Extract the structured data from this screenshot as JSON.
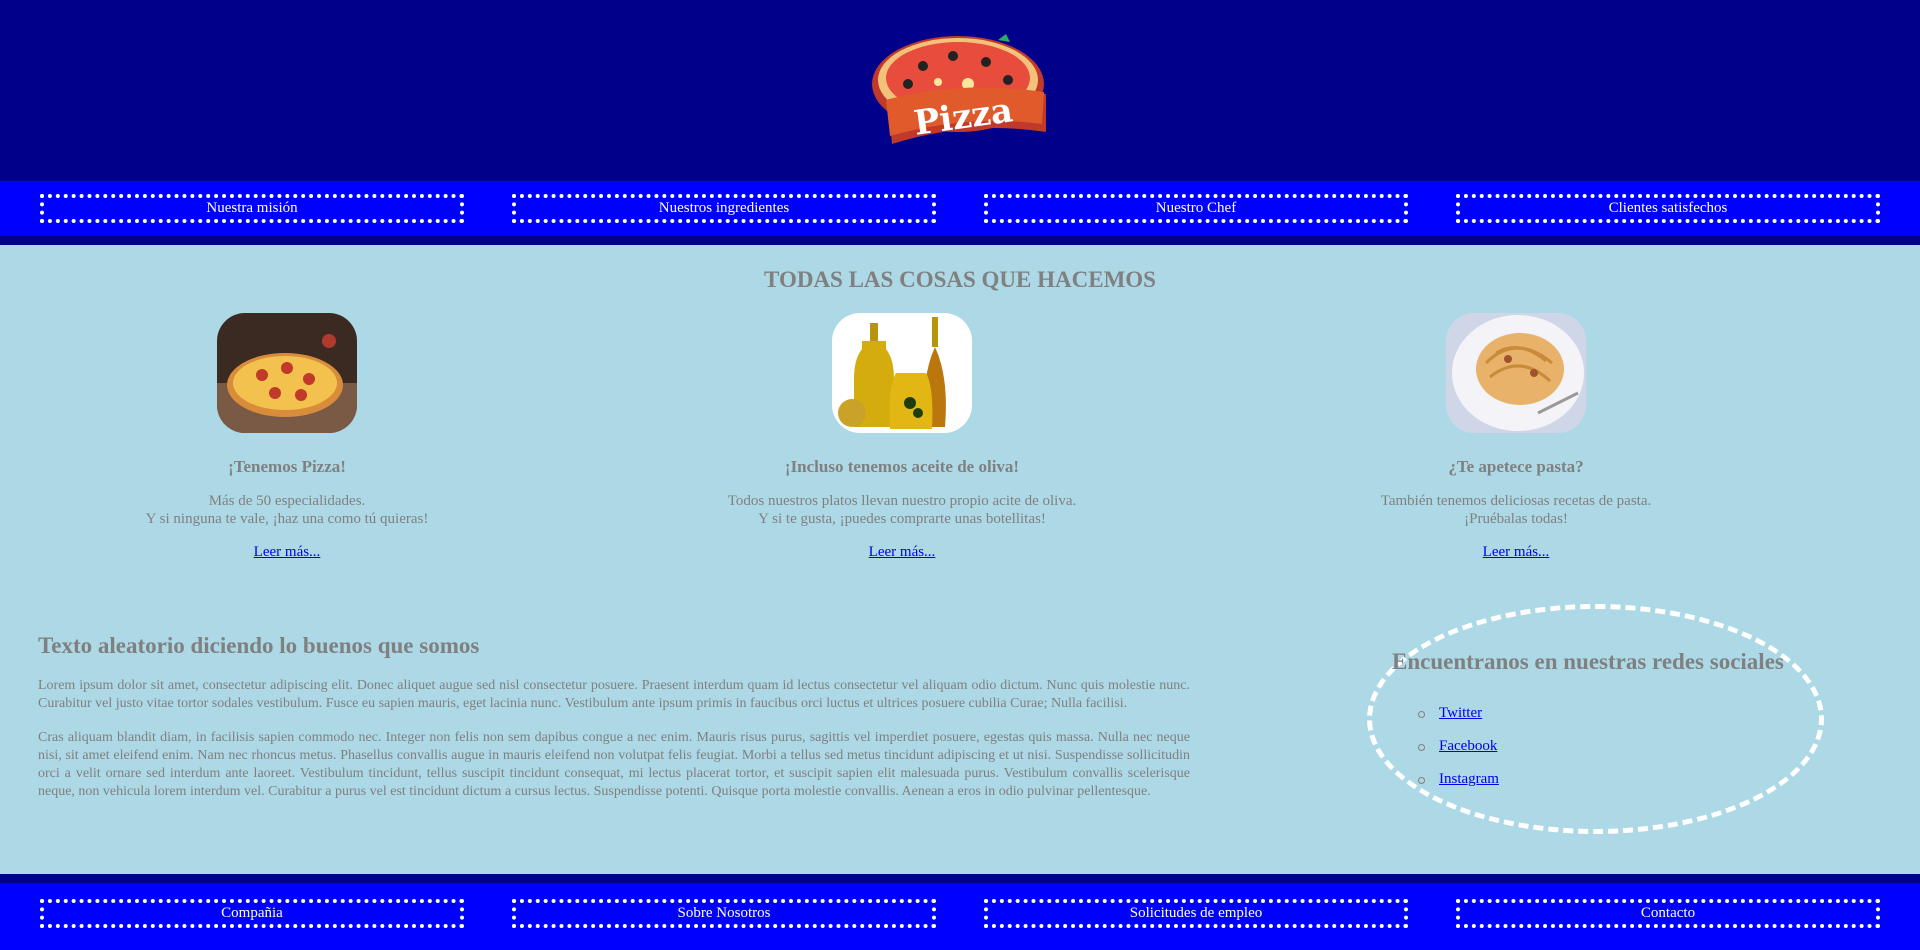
{
  "header": {
    "logo_text": "Pizza"
  },
  "nav": {
    "items": [
      {
        "label": "Nuestra misión"
      },
      {
        "label": "Nuestros ingredientes"
      },
      {
        "label": "Nuestro Chef"
      },
      {
        "label": "Clientes satisfechos"
      }
    ]
  },
  "main": {
    "title": "TODAS LAS COSAS QUE HACEMOS",
    "features": [
      {
        "title": "¡Tenemos Pizza!",
        "line1": "Más de 50 especialidades.",
        "line2": "Y si ninguna te vale, ¡haz una como tú quieras!",
        "link": "Leer más..."
      },
      {
        "title": "¡Incluso tenemos aceite de oliva!",
        "line1": "Todos nuestros platos llevan nuestro propio acite de oliva.",
        "line2": "Y si te gusta, ¡puedes comprarte unas botellitas!",
        "link": "Leer más..."
      },
      {
        "title": "¿Te apetece pasta?",
        "line1": "También tenemos deliciosas recetas de pasta.",
        "line2": "¡Pruébalas todas!",
        "link": "Leer más..."
      }
    ]
  },
  "about": {
    "title": "Texto aleatorio diciendo lo buenos que somos",
    "p1": "Lorem ipsum dolor sit amet, consectetur adipiscing elit. Donec aliquet augue sed nisl consectetur posuere. Praesent interdum quam id lectus consectetur vel aliquam odio dictum. Nunc quis molestie nunc. Curabitur vel justo vitae tortor sodales vestibulum. Fusce eu sapien mauris, eget lacinia nunc. Vestibulum ante ipsum primis in faucibus orci luctus et ultrices posuere cubilia Curae; Nulla facilisi.",
    "p2": "Cras aliquam blandit diam, in facilisis sapien commodo nec. Integer non felis non sem dapibus congue a nec enim. Mauris risus purus, sagittis vel imperdiet posuere, egestas quis massa. Nulla nec neque nisi, sit amet eleifend enim. Nam nec rhoncus metus. Phasellus convallis augue in mauris eleifend non volutpat felis feugiat. Morbi a tellus sed metus tincidunt adipiscing et ut nisi. Suspendisse sollicitudin orci a velit ornare sed interdum ante laoreet. Vestibulum tincidunt, tellus suscipit tincidunt consequat, mi lectus placerat tortor, et suscipit sapien elit malesuada purus. Vestibulum convallis scelerisque neque, non vehicula lorem interdum vel. Curabitur a purus vel est tincidunt dictum a cursus lectus. Suspendisse potenti. Quisque porta molestie convallis. Aenean a eros in odio pulvinar pellentesque."
  },
  "social": {
    "title": "Encuentranos en nuestras redes sociales",
    "links": [
      {
        "label": "Twitter"
      },
      {
        "label": "Facebook"
      },
      {
        "label": "Instagram"
      }
    ]
  },
  "footer": {
    "items": [
      {
        "label": "Compañia"
      },
      {
        "label": "Sobre Nosotros"
      },
      {
        "label": "Solicitudes de empleo"
      },
      {
        "label": "Contacto"
      }
    ]
  },
  "colors": {
    "header_bg": "#00008b",
    "nav_bg": "#0000ff",
    "body_bg": "#add8e6",
    "text": "#808080",
    "link": "#0000ee"
  }
}
